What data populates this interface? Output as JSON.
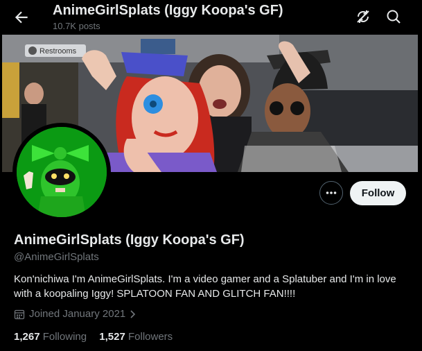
{
  "header": {
    "title": "AnimeGirlSplats (Iggy Koopa's GF)",
    "post_count": "10.7K posts"
  },
  "banner": {
    "sign_text": "Restrooms"
  },
  "actions": {
    "follow_label": "Follow"
  },
  "profile": {
    "display_name": "AnimeGirlSplats (Iggy Koopa's GF)",
    "handle": "@AnimeGirlSplats",
    "bio": "Kon'nichiwa I'm AnimeGirlSplats. I'm a video gamer and a Splatuber and I'm in love with a koopaling Iggy! SPLATOON FAN AND GLITCH FAN!!!!",
    "joined": "Joined January 2021",
    "following_count": "1,267",
    "following_label": "Following",
    "followers_count": "1,527",
    "followers_label": "Followers"
  },
  "colors": {
    "background": "#000000",
    "text_primary": "#e7e9ea",
    "text_secondary": "#71767b",
    "follow_button_bg": "#eff3f4",
    "avatar_green": "#0b9a13"
  }
}
